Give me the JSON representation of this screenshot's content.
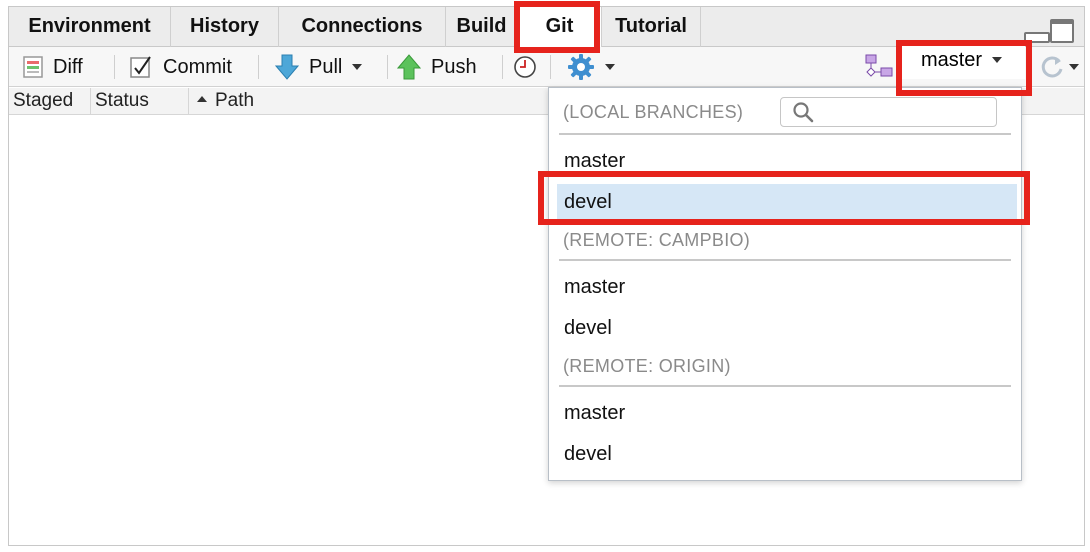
{
  "tabs": [
    {
      "label": "Environment"
    },
    {
      "label": "History"
    },
    {
      "label": "Connections"
    },
    {
      "label": "Build"
    },
    {
      "label": "Git"
    },
    {
      "label": "Tutorial"
    }
  ],
  "toolbar": {
    "diff_label": "Diff",
    "commit_label": "Commit",
    "pull_label": "Pull",
    "push_label": "Push",
    "current_branch": "master"
  },
  "columns": {
    "staged": "Staged",
    "status": "Status",
    "path": "Path"
  },
  "branch_menu": {
    "sections": [
      {
        "header": "(LOCAL BRANCHES)",
        "items": [
          "master",
          "devel"
        ]
      },
      {
        "header": "(REMOTE: CAMPBIO)",
        "items": [
          "master",
          "devel"
        ]
      },
      {
        "header": "(REMOTE: ORIGIN)",
        "items": [
          "master",
          "devel"
        ]
      }
    ],
    "highlighted": "devel"
  },
  "colors": {
    "annotation": "#e6231c",
    "highlight": "#d6e7f6"
  }
}
